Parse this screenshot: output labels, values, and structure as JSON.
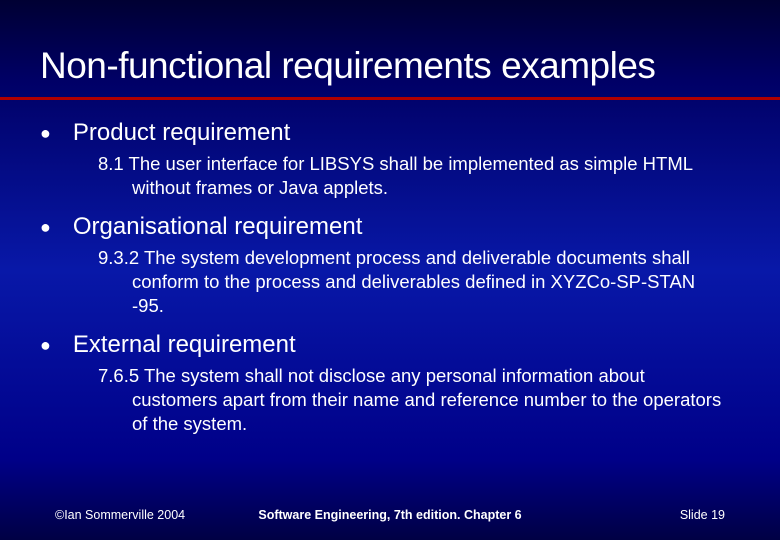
{
  "title": "Non-functional requirements examples",
  "items": [
    {
      "heading": "Product requirement",
      "body": "8.1  The user interface for LIBSYS shall be implemented as simple HTML without frames or Java applets."
    },
    {
      "heading": "Organisational requirement",
      "body": "9.3.2  The system development process and deliverable documents shall conform to the process and deliverables defined in XYZCo-SP-STAN -95."
    },
    {
      "heading": "External requirement",
      "body": "7.6.5  The system shall not disclose any personal information about customers apart from their name and reference number to the operators of the system."
    }
  ],
  "footer": {
    "left": "©Ian Sommerville 2004",
    "center": "Software Engineering, 7th edition. Chapter 6",
    "right": "Slide  19"
  }
}
